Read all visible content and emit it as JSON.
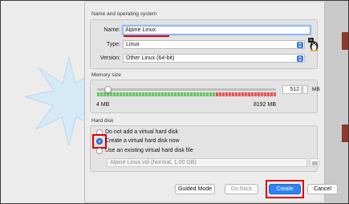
{
  "sections": {
    "name_os": "Name and operating system",
    "memory": "Memory size",
    "hard_disk": "Hard disk"
  },
  "fields": {
    "name_label": "Name:",
    "name_value": "Alpine Linux",
    "type_label": "Type:",
    "type_value": "Linux",
    "version_label": "Version:",
    "version_value": "Other Linux (64-bit)"
  },
  "memory": {
    "value": "512",
    "unit": "MB",
    "min_label": "4 MB",
    "max_label": "8192 MB",
    "fraction": 0.062
  },
  "hard_disk": {
    "options": [
      "Do not add a virtual hard disk",
      "Create a virtual hard disk now",
      "Use an existing virtual hard disk file"
    ],
    "selected_index": 1,
    "existing_file": "Alpine Linux.vdi (Normal, 1.00 GB)"
  },
  "buttons": {
    "guided_mode": "Guided Mode",
    "go_back": "Go Back",
    "create": "Create",
    "cancel": "Cancel"
  },
  "icons": {
    "os": "linux-penguin-icon",
    "badge": "64"
  },
  "colors": {
    "accent": "#2f82f2",
    "highlight": "#e10000"
  }
}
